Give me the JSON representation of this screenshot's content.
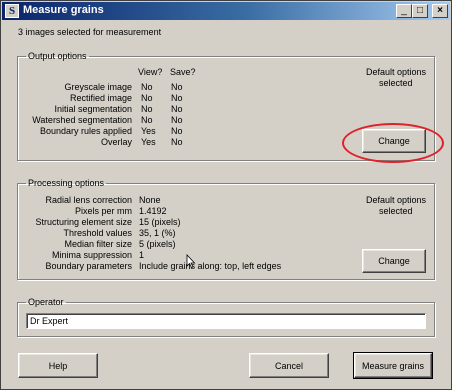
{
  "window": {
    "title": "Measure grains",
    "title_icon_letter": "S"
  },
  "titlebar_buttons": {
    "minimize": "_",
    "maximize": "□",
    "close": "×"
  },
  "subtitle": "3 images selected for measurement",
  "output_options": {
    "legend": "Output options",
    "col_view": "View?",
    "col_save": "Save?",
    "rows": [
      {
        "label": "Greyscale image",
        "view": "No",
        "save": "No"
      },
      {
        "label": "Rectified image",
        "view": "No",
        "save": "No"
      },
      {
        "label": "Initial segmentation",
        "view": "No",
        "save": "No"
      },
      {
        "label": "Watershed segmentation",
        "view": "No",
        "save": "No"
      },
      {
        "label": "Boundary rules applied",
        "view": "Yes",
        "save": "No"
      },
      {
        "label": "Overlay",
        "view": "Yes",
        "save": "No"
      }
    ],
    "default_note_1": "Default options",
    "default_note_2": "selected",
    "change_label": "Change"
  },
  "processing_options": {
    "legend": "Processing options",
    "rows": [
      {
        "label": "Radial lens correction",
        "value": "None"
      },
      {
        "label": "Pixels per mm",
        "value": "1.4192"
      },
      {
        "label": "Structuring element size",
        "value": "15 (pixels)"
      },
      {
        "label": "Threshold values",
        "value": "35, 1 (%)"
      },
      {
        "label": "Median filter size",
        "value": "5 (pixels)"
      },
      {
        "label": "Minima suppression",
        "value": "1"
      },
      {
        "label": "Boundary parameters",
        "value": "Include grains along: top, left edges"
      }
    ],
    "default_note_1": "Default options",
    "default_note_2": "selected",
    "change_label": "Change"
  },
  "operator": {
    "legend": "Operator",
    "value": "Dr Expert"
  },
  "buttons": {
    "help": "Help",
    "cancel": "Cancel",
    "measure": "Measure grains"
  },
  "colors": {
    "annotation": "#e0202a",
    "titlebar": "#0a246a",
    "face": "#d4d0c8"
  }
}
